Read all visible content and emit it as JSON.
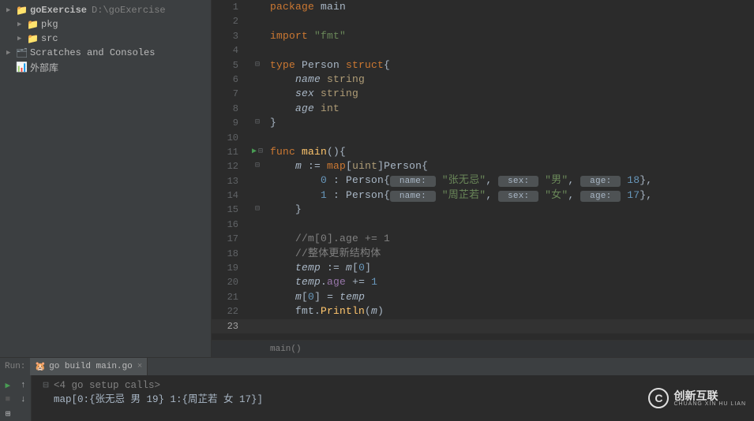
{
  "sidebar": {
    "items": [
      {
        "arrow": "▶",
        "icon": "📁",
        "label": "goExercise",
        "path": "D:\\goExercise"
      },
      {
        "arrow": "▶",
        "icon": "📁",
        "label": "pkg",
        "path": ""
      },
      {
        "arrow": "▶",
        "icon": "📁",
        "label": "src",
        "path": ""
      },
      {
        "arrow": "▶",
        "icon": "🗂",
        "label": "Scratches and Consoles",
        "path": ""
      },
      {
        "arrow": "",
        "icon": "📊",
        "label": "外部库",
        "path": ""
      }
    ]
  },
  "code": {
    "lines": [
      {
        "n": "1",
        "fold": "",
        "segs": [
          {
            "t": "package ",
            "c": "kw"
          },
          {
            "t": "main",
            "c": "id"
          }
        ]
      },
      {
        "n": "2",
        "fold": "",
        "segs": []
      },
      {
        "n": "3",
        "fold": "",
        "segs": [
          {
            "t": "import ",
            "c": "kw"
          },
          {
            "t": "\"fmt\"",
            "c": "str"
          }
        ]
      },
      {
        "n": "4",
        "fold": "",
        "segs": []
      },
      {
        "n": "5",
        "fold": "⊟",
        "segs": [
          {
            "t": "type ",
            "c": "kw"
          },
          {
            "t": "Person ",
            "c": "id"
          },
          {
            "t": "struct",
            "c": "kw"
          },
          {
            "t": "{",
            "c": "op"
          }
        ]
      },
      {
        "n": "6",
        "fold": "",
        "segs": [
          {
            "t": "    ",
            "c": ""
          },
          {
            "t": "name",
            "c": "var-it"
          },
          {
            "t": " string",
            "c": "typ"
          }
        ]
      },
      {
        "n": "7",
        "fold": "",
        "segs": [
          {
            "t": "    ",
            "c": ""
          },
          {
            "t": "sex",
            "c": "var-it"
          },
          {
            "t": " string",
            "c": "typ"
          }
        ]
      },
      {
        "n": "8",
        "fold": "",
        "segs": [
          {
            "t": "    ",
            "c": ""
          },
          {
            "t": "age",
            "c": "var-it"
          },
          {
            "t": " int",
            "c": "typ"
          }
        ]
      },
      {
        "n": "9",
        "fold": "⊟",
        "segs": [
          {
            "t": "}",
            "c": "op"
          }
        ]
      },
      {
        "n": "10",
        "fold": "",
        "segs": []
      },
      {
        "n": "11",
        "fold": "run⊟",
        "segs": [
          {
            "t": "func ",
            "c": "kw"
          },
          {
            "t": "main",
            "c": "fn"
          },
          {
            "t": "(){",
            "c": "op"
          }
        ]
      },
      {
        "n": "12",
        "fold": "⊟",
        "segs": [
          {
            "t": "    ",
            "c": ""
          },
          {
            "t": "m",
            "c": "var-it"
          },
          {
            "t": " := ",
            "c": "op"
          },
          {
            "t": "map",
            "c": "kw"
          },
          {
            "t": "[",
            "c": "op"
          },
          {
            "t": "uint",
            "c": "typ"
          },
          {
            "t": "]",
            "c": "op"
          },
          {
            "t": "Person",
            "c": "id"
          },
          {
            "t": "{",
            "c": "op"
          }
        ]
      },
      {
        "n": "13",
        "fold": "",
        "segs": [
          {
            "t": "        ",
            "c": ""
          },
          {
            "t": "0",
            "c": "num"
          },
          {
            "t": " : ",
            "c": "op"
          },
          {
            "t": "Person",
            "c": "id"
          },
          {
            "t": "{",
            "c": "op"
          },
          {
            "t": " name: ",
            "c": "hint-box"
          },
          {
            "t": " ",
            "c": ""
          },
          {
            "t": "\"张无忌\"",
            "c": "str"
          },
          {
            "t": ", ",
            "c": "op"
          },
          {
            "t": " sex: ",
            "c": "hint-box"
          },
          {
            "t": " ",
            "c": ""
          },
          {
            "t": "\"男\"",
            "c": "str"
          },
          {
            "t": ", ",
            "c": "op"
          },
          {
            "t": " age: ",
            "c": "hint-box"
          },
          {
            "t": " ",
            "c": ""
          },
          {
            "t": "18",
            "c": "num"
          },
          {
            "t": "},",
            "c": "op"
          }
        ]
      },
      {
        "n": "14",
        "fold": "",
        "segs": [
          {
            "t": "        ",
            "c": ""
          },
          {
            "t": "1",
            "c": "num"
          },
          {
            "t": " : ",
            "c": "op"
          },
          {
            "t": "Person",
            "c": "id"
          },
          {
            "t": "{",
            "c": "op"
          },
          {
            "t": " name: ",
            "c": "hint-box"
          },
          {
            "t": " ",
            "c": ""
          },
          {
            "t": "\"周芷若\"",
            "c": "str"
          },
          {
            "t": ", ",
            "c": "op"
          },
          {
            "t": " sex: ",
            "c": "hint-box"
          },
          {
            "t": " ",
            "c": ""
          },
          {
            "t": "\"女\"",
            "c": "str"
          },
          {
            "t": ", ",
            "c": "op"
          },
          {
            "t": " age: ",
            "c": "hint-box"
          },
          {
            "t": " ",
            "c": ""
          },
          {
            "t": "17",
            "c": "num"
          },
          {
            "t": "},",
            "c": "op"
          }
        ]
      },
      {
        "n": "15",
        "fold": "⊟",
        "segs": [
          {
            "t": "    }",
            "c": "op"
          }
        ]
      },
      {
        "n": "16",
        "fold": "",
        "segs": []
      },
      {
        "n": "17",
        "fold": "",
        "segs": [
          {
            "t": "    //m[0].age += 1",
            "c": "cmt"
          }
        ]
      },
      {
        "n": "18",
        "fold": "",
        "segs": [
          {
            "t": "    //整体更新结构体",
            "c": "cmt"
          }
        ]
      },
      {
        "n": "19",
        "fold": "",
        "segs": [
          {
            "t": "    ",
            "c": ""
          },
          {
            "t": "temp",
            "c": "var-it"
          },
          {
            "t": " := ",
            "c": "op"
          },
          {
            "t": "m",
            "c": "var-it"
          },
          {
            "t": "[",
            "c": "op"
          },
          {
            "t": "0",
            "c": "num"
          },
          {
            "t": "]",
            "c": "op"
          }
        ]
      },
      {
        "n": "20",
        "fold": "",
        "segs": [
          {
            "t": "    ",
            "c": ""
          },
          {
            "t": "temp",
            "c": "var-it"
          },
          {
            "t": ".",
            "c": "op"
          },
          {
            "t": "age",
            "c": "field"
          },
          {
            "t": " += ",
            "c": "op"
          },
          {
            "t": "1",
            "c": "num"
          }
        ]
      },
      {
        "n": "21",
        "fold": "",
        "segs": [
          {
            "t": "    ",
            "c": ""
          },
          {
            "t": "m",
            "c": "var-it"
          },
          {
            "t": "[",
            "c": "op"
          },
          {
            "t": "0",
            "c": "num"
          },
          {
            "t": "] = ",
            "c": "op"
          },
          {
            "t": "temp",
            "c": "var-it"
          }
        ]
      },
      {
        "n": "22",
        "fold": "",
        "segs": [
          {
            "t": "    fmt.",
            "c": "id"
          },
          {
            "t": "Println",
            "c": "fn"
          },
          {
            "t": "(",
            "c": "op"
          },
          {
            "t": "m",
            "c": "var-it"
          },
          {
            "t": ")",
            "c": "op"
          }
        ]
      },
      {
        "n": "23",
        "fold": "",
        "current": true,
        "segs": [
          {
            "t": "",
            "c": ""
          }
        ]
      }
    ]
  },
  "breadcrumb": "main()",
  "run": {
    "label": "Run:",
    "tab": "go build main.go",
    "console": [
      "<4 go setup calls>",
      "map[0:{张无忌 男 19} 1:{周芷若 女 17}]"
    ]
  },
  "watermark": {
    "cn": "创新互联",
    "en": "CHUANG XIN HU LIAN",
    "logo": "C"
  }
}
